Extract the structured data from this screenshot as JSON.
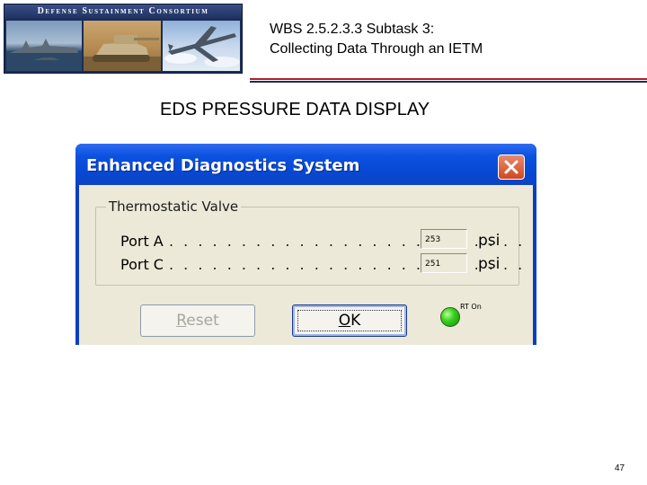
{
  "header": {
    "banner_text": "Defense Sustainment Consortium",
    "title_line1": "WBS 2.5.2.3.3 Subtask 3:",
    "title_line2": "Collecting Data Through an IETM",
    "accent_red": "#b0202a",
    "accent_navy": "#1b2d57"
  },
  "section_title": "EDS PRESSURE DATA DISPLAY",
  "dialog": {
    "title": "Enhanced Diagnostics System",
    "close_icon": "close-x-icon",
    "titlebar_color": "#0b51e0",
    "group": {
      "label": "Thermostatic Valve",
      "rows": [
        {
          "label": "Port A",
          "dots": ". . . . . . . . . . . . . . . . . . . . . . . . .",
          "value": "253",
          "unit": "psi"
        },
        {
          "label": "Port C",
          "dots": ". . . . . . . . . . . . . . . . . . . . . . . . .",
          "value": "251",
          "unit": "psi"
        }
      ]
    },
    "buttons": {
      "reset_mnemonic": "R",
      "reset_rest": "eset",
      "ok_mnemonic": "O",
      "ok_rest": "K"
    },
    "indicator": {
      "label": "RT On",
      "color": "#38d21c",
      "icon": "status-led-icon"
    }
  },
  "page_number": "47"
}
